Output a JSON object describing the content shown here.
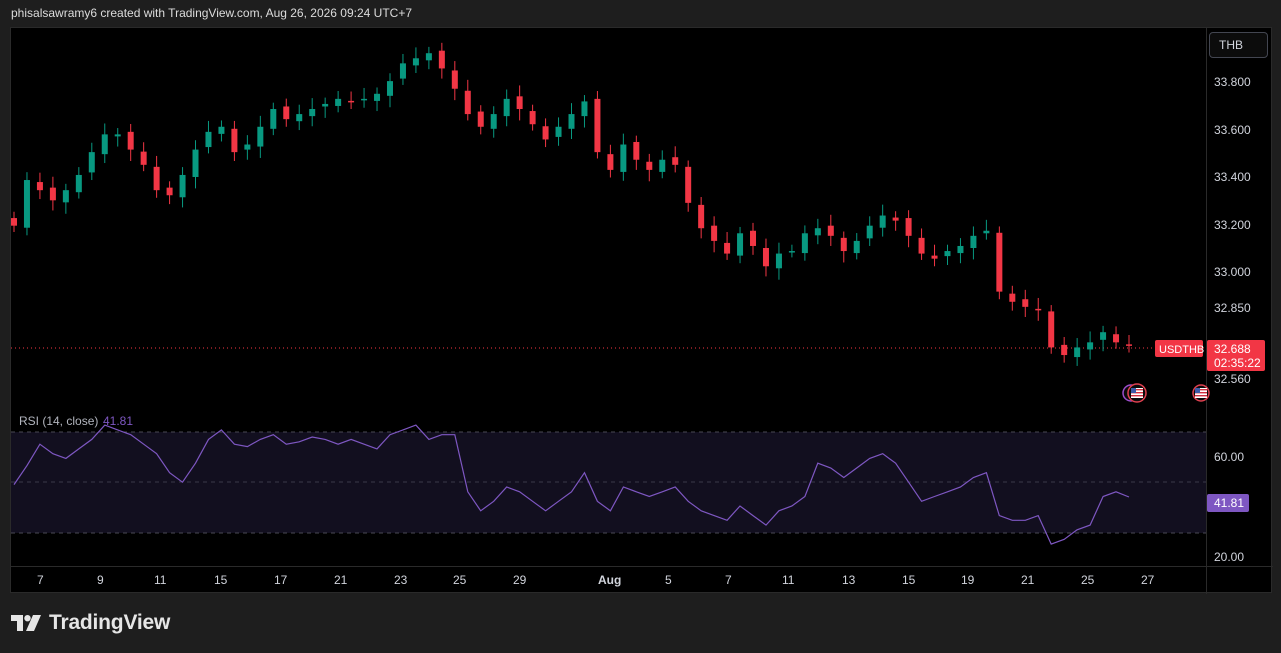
{
  "header": {
    "text": "phisalsawramy6 created with TradingView.com, Aug 26, 2026 09:24 UTC+7"
  },
  "currency_button": "THB",
  "brand": {
    "name": "TradingView"
  },
  "price_axis": {
    "labels": [
      "33.800",
      "33.600",
      "33.400",
      "33.200",
      "33.000",
      "32.850",
      "32.560"
    ]
  },
  "last_price": {
    "symbol": "USDTHB",
    "price": "32.688",
    "countdown": "02:35:22",
    "color": "#f23645"
  },
  "rsi": {
    "title": "RSI (14, close)",
    "value": "41.81",
    "axis_labels": [
      "60.00",
      "20.00"
    ],
    "color": "#7e57c2"
  },
  "time_axis": {
    "labels": [
      "7",
      "9",
      "11",
      "15",
      "17",
      "21",
      "23",
      "25",
      "29",
      "Aug",
      "5",
      "7",
      "11",
      "13",
      "15",
      "19",
      "21",
      "25",
      "27"
    ]
  },
  "colors": {
    "up": "#089981",
    "down": "#f23645",
    "background": "#000000",
    "rsi_band": "#120f1f"
  },
  "chart_data": [
    {
      "type": "candlestick",
      "symbol": "USDTHB",
      "ylim": [
        32.52,
        33.9
      ],
      "approx_close_path": [
        33.16,
        33.34,
        33.3,
        33.26,
        33.3,
        33.36,
        33.45,
        33.52,
        33.52,
        33.46,
        33.4,
        33.3,
        33.28,
        33.36,
        33.46,
        33.53,
        33.55,
        33.45,
        33.48,
        33.55,
        33.62,
        33.58,
        33.6,
        33.62,
        33.64,
        33.66,
        33.65,
        33.66,
        33.68,
        33.73,
        33.8,
        33.82,
        33.84,
        33.78,
        33.7,
        33.6,
        33.55,
        33.6,
        33.66,
        33.62,
        33.56,
        33.5,
        33.55,
        33.6,
        33.65,
        33.45,
        33.38,
        33.48,
        33.42,
        33.38,
        33.42,
        33.4,
        33.25,
        33.15,
        33.1,
        33.05,
        33.13,
        33.08,
        33.0,
        33.05,
        33.06,
        33.13,
        33.15,
        33.12,
        33.06,
        33.1,
        33.16,
        33.2,
        33.18,
        33.12,
        33.05,
        33.03,
        33.06,
        33.08,
        33.12,
        33.14,
        32.9,
        32.86,
        32.84,
        32.83,
        32.68,
        32.65,
        32.68,
        32.7,
        32.74,
        32.7,
        32.69
      ],
      "series": [
        {
          "name": "USDTHB",
          "values": [
            33.16,
            33.34,
            33.3,
            33.26,
            33.3,
            33.36,
            33.45,
            33.52,
            33.52,
            33.46,
            33.4,
            33.3,
            33.28,
            33.36,
            33.46,
            33.53,
            33.55,
            33.45,
            33.48,
            33.55,
            33.62,
            33.58,
            33.6,
            33.62,
            33.64,
            33.66,
            33.65,
            33.66,
            33.68,
            33.73,
            33.8,
            33.82,
            33.84,
            33.78,
            33.7,
            33.6,
            33.55,
            33.6,
            33.66,
            33.62,
            33.56,
            33.5,
            33.55,
            33.6,
            33.65,
            33.45,
            33.38,
            33.48,
            33.42,
            33.38,
            33.42,
            33.4,
            33.25,
            33.15,
            33.1,
            33.05,
            33.13,
            33.08,
            33.0,
            33.05,
            33.06,
            33.13,
            33.15,
            33.12,
            33.06,
            33.1,
            33.16,
            33.2,
            33.18,
            33.12,
            33.05,
            33.03,
            33.06,
            33.08,
            33.12,
            33.14,
            32.9,
            32.86,
            32.84,
            32.83,
            32.68,
            32.65,
            32.68,
            32.7,
            32.74,
            32.7,
            32.69
          ]
        }
      ],
      "last": 32.688
    },
    {
      "type": "line",
      "title": "RSI (14, close)",
      "ylim": [
        17,
        75
      ],
      "bands": [
        30,
        50,
        70
      ],
      "series": [
        {
          "name": "RSI (14, close)",
          "values": [
            47,
            55,
            64,
            60,
            58,
            62,
            66,
            72,
            70,
            68,
            64,
            60,
            52,
            48,
            56,
            66,
            70,
            64,
            63,
            66,
            68,
            64,
            65,
            67,
            66,
            64,
            66,
            64,
            62,
            68,
            70,
            72,
            66,
            68,
            68,
            44,
            36,
            40,
            46,
            44,
            40,
            36,
            40,
            44,
            52,
            40,
            36,
            46,
            44,
            42,
            44,
            46,
            40,
            36,
            34,
            32,
            38,
            34,
            30,
            36,
            38,
            42,
            56,
            54,
            50,
            54,
            58,
            60,
            56,
            48,
            40,
            42,
            44,
            46,
            50,
            52,
            34,
            32,
            32,
            34,
            22,
            24,
            28,
            30,
            42,
            44,
            41.81
          ]
        }
      ]
    }
  ]
}
